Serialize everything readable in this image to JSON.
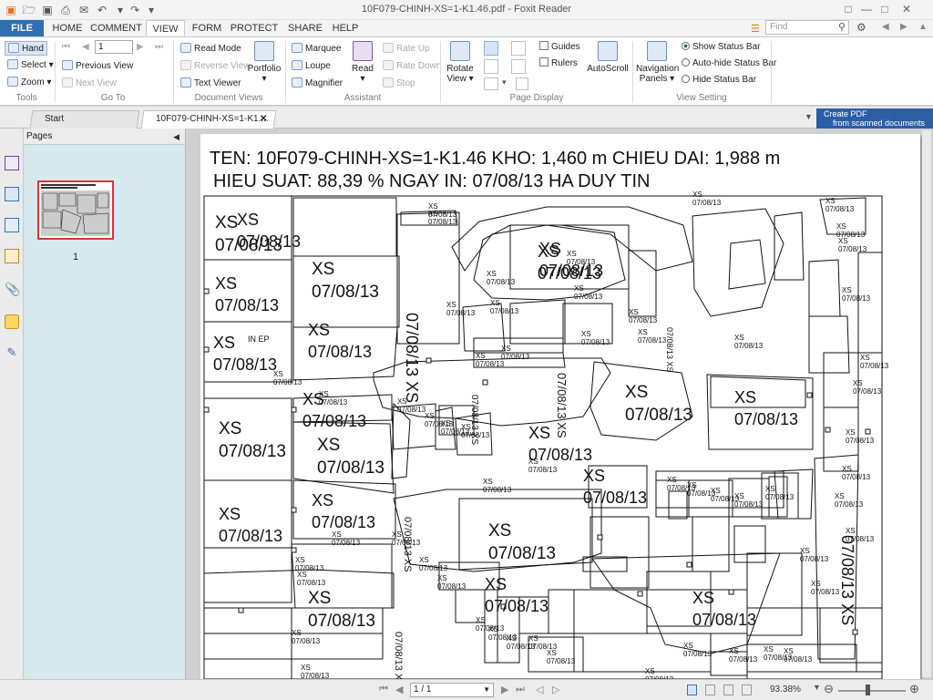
{
  "window": {
    "title": "10F079-CHINH-XS=1-K1.46.pdf - Foxit Reader"
  },
  "quick_access": [
    "app-logo-icon",
    "open-icon",
    "save-icon",
    "print-icon",
    "email-icon",
    "undo-icon",
    "redo-icon",
    "customize-icon"
  ],
  "tabs": {
    "file": "FILE",
    "home": "HOME",
    "comment": "COMMENT",
    "view": "VIEW",
    "form": "FORM",
    "protect": "PROTECT",
    "share": "SHARE",
    "help": "HELP"
  },
  "search": {
    "placeholder": "Find"
  },
  "ribbon": {
    "tools": {
      "hand": "Hand",
      "select": "Select",
      "zoom": "Zoom",
      "label": "Tools"
    },
    "goto": {
      "page_value": "1",
      "previous_view": "Previous View",
      "next_view": "Next View",
      "label": "Go To"
    },
    "document_views": {
      "read_mode": "Read Mode",
      "reverse_view": "Reverse View",
      "text_viewer": "Text Viewer",
      "portfolio": "Portfolio",
      "label": "Document Views"
    },
    "assistant": {
      "marquee": "Marquee",
      "loupe": "Loupe",
      "magnifier": "Magnifier",
      "read": "Read",
      "rate_up": "Rate Up",
      "rate_down": "Rate Down",
      "stop": "Stop",
      "label": "Assistant"
    },
    "page_display": {
      "rotate_view_1": "Rotate",
      "rotate_view_2": "View",
      "guides": "Guides",
      "rulers": "Rulers",
      "autoscroll": "AutoScroll",
      "label": "Page Display"
    },
    "view_setting": {
      "nav_panels_1": "Navigation",
      "nav_panels_2": "Panels",
      "show_status": "Show Status Bar",
      "autohide_status": "Auto-hide Status Bar",
      "hide_status": "Hide Status Bar",
      "label": "View Setting"
    }
  },
  "doc_tabs": {
    "start": "Start",
    "current": "10F079-CHINH-XS=1-K1...."
  },
  "ad": {
    "line1": "Create PDF",
    "line2": "from scanned documents"
  },
  "pages_panel": {
    "title": "Pages",
    "thumbnail_number": "1"
  },
  "document": {
    "header_line1": "TEN: 10F079-CHINH-XS=1-K1.46 KHO: 1,460 m CHIEU DAI: 1,988 m",
    "header_line2": "HIEU SUAT: 88,39 % NGAY IN: 07/08/13 HA DUY TIN",
    "piece_label": "XS",
    "piece_date": "07/08/13",
    "piece_label_mirrored": "IN EP"
  },
  "status": {
    "page_indicator": "1 / 1",
    "zoom": "93.38%"
  },
  "colors": {
    "file_tab": "#2f6fb4",
    "pages_panel_bg": "#d6e9ee",
    "thumb_border": "#dd3333",
    "ad_bg": "#2c5ea6"
  }
}
